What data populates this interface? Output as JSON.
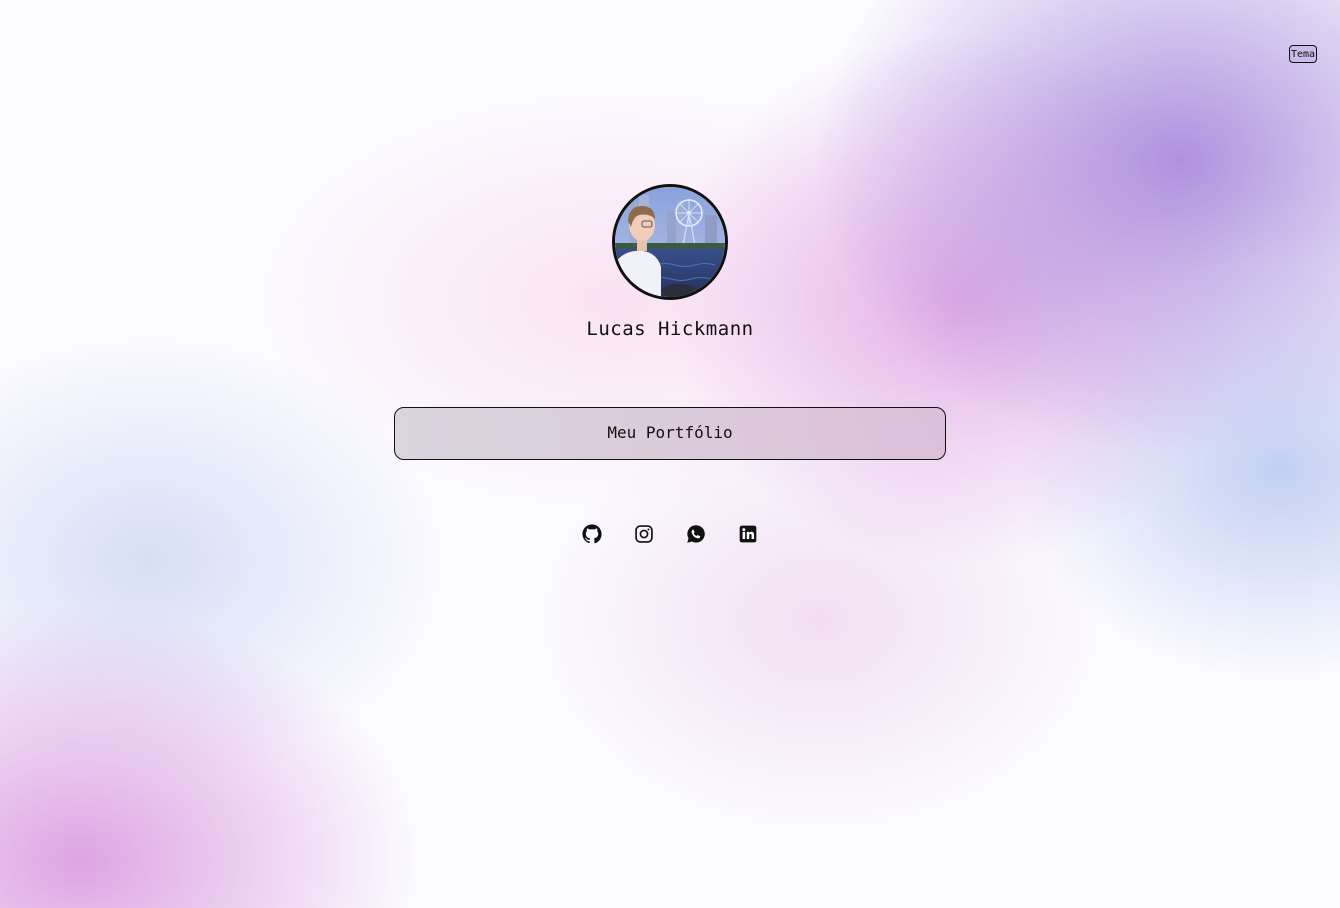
{
  "theme_toggle": {
    "label": "Tema"
  },
  "profile": {
    "name": "Lucas Hickmann",
    "avatar": "profile-photo"
  },
  "primary_link": {
    "label": "Meu Portfólio"
  },
  "social_links": [
    {
      "icon": "github-icon"
    },
    {
      "icon": "instagram-icon"
    },
    {
      "icon": "whatsapp-icon"
    },
    {
      "icon": "linkedin-icon"
    }
  ]
}
